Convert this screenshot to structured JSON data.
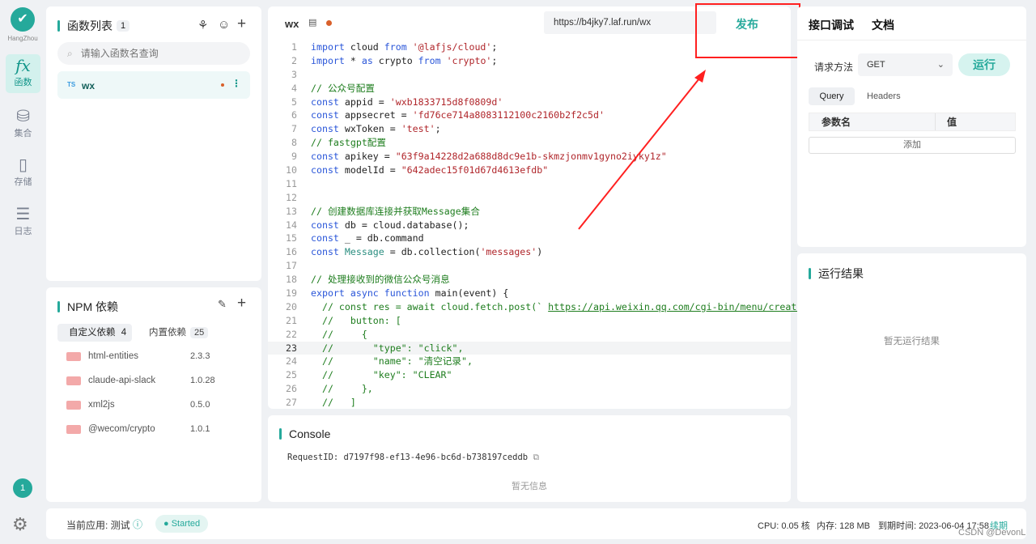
{
  "sidebar": {
    "region": "HangZhou",
    "items": [
      {
        "label": "函数",
        "icon": "function-icon"
      },
      {
        "label": "集合",
        "icon": "database-icon"
      },
      {
        "label": "存储",
        "icon": "storage-icon"
      },
      {
        "label": "日志",
        "icon": "log-icon"
      }
    ],
    "notification_count": "1"
  },
  "functions": {
    "title": "函数列表",
    "count": "1",
    "search_placeholder": "请输入函数名查询",
    "items": [
      {
        "lang": "TS",
        "name": "wx"
      }
    ]
  },
  "npm": {
    "title": "NPM 依赖",
    "tabs": [
      {
        "label": "自定义依赖",
        "count": "4"
      },
      {
        "label": "内置依赖",
        "count": "25"
      }
    ],
    "packages": [
      {
        "name": "html-entities",
        "version": "2.3.3"
      },
      {
        "name": "claude-api-slack",
        "version": "1.0.28"
      },
      {
        "name": "xml2js",
        "version": "0.5.0"
      },
      {
        "name": "@wecom/crypto",
        "version": "1.0.1"
      }
    ]
  },
  "editor": {
    "filename": "wx",
    "url": "https://b4jky7.laf.run/wx",
    "publish_label": "发布",
    "highlighted_line": 23,
    "lines": [
      [
        [
          "kw",
          "import"
        ],
        [
          "tx",
          " cloud "
        ],
        [
          "kw",
          "from"
        ],
        [
          "tx",
          " "
        ],
        [
          "str",
          "'@lafjs/cloud'"
        ],
        [
          "tx",
          ";"
        ]
      ],
      [
        [
          "kw",
          "import"
        ],
        [
          "tx",
          " * "
        ],
        [
          "kw",
          "as"
        ],
        [
          "tx",
          " crypto "
        ],
        [
          "kw",
          "from"
        ],
        [
          "tx",
          " "
        ],
        [
          "str",
          "'crypto'"
        ],
        [
          "tx",
          ";"
        ]
      ],
      [],
      [
        [
          "cm",
          "// 公众号配置"
        ]
      ],
      [
        [
          "kw",
          "const"
        ],
        [
          "tx",
          " appid = "
        ],
        [
          "str",
          "'wxb1833715d8f0809d'"
        ]
      ],
      [
        [
          "kw",
          "const"
        ],
        [
          "tx",
          " appsecret = "
        ],
        [
          "str",
          "'fd76ce714a8083112100c2160b2f2c5d'"
        ]
      ],
      [
        [
          "kw",
          "const"
        ],
        [
          "tx",
          " wxToken = "
        ],
        [
          "str",
          "'test'"
        ],
        [
          "tx",
          ";"
        ]
      ],
      [
        [
          "cm",
          "// fastgpt配置"
        ]
      ],
      [
        [
          "kw",
          "const"
        ],
        [
          "tx",
          " apikey = "
        ],
        [
          "str",
          "\"63f9a14228d2a688d8dc9e1b-skmzjonmv1gyno2iyky1z\""
        ]
      ],
      [
        [
          "kw",
          "const"
        ],
        [
          "tx",
          " modelId = "
        ],
        [
          "str",
          "\"642adec15f01d67d4613efdb\""
        ]
      ],
      [],
      [],
      [
        [
          "cm",
          "// 创建数据库连接并获取Message集合"
        ]
      ],
      [
        [
          "kw",
          "const"
        ],
        [
          "tx",
          " db = cloud.database();"
        ]
      ],
      [
        [
          "kw",
          "const"
        ],
        [
          "tx",
          " _ = db.command"
        ]
      ],
      [
        [
          "kw",
          "const"
        ],
        [
          "tx",
          " "
        ],
        [
          "ty",
          "Message"
        ],
        [
          "tx",
          " = db.collection("
        ],
        [
          "str",
          "'messages'"
        ],
        [
          "tx",
          ")"
        ]
      ],
      [],
      [
        [
          "cm",
          "// 处理接收到的微信公众号消息"
        ]
      ],
      [
        [
          "kw",
          "export"
        ],
        [
          "tx",
          " "
        ],
        [
          "kw",
          "async"
        ],
        [
          "tx",
          " "
        ],
        [
          "kw",
          "function"
        ],
        [
          "tx",
          " main(event) {"
        ]
      ],
      [
        [
          "cm",
          "  // const res = await cloud.fetch.post(` "
        ],
        [
          "url",
          "https://api.weixin.qq.com/cgi-bin/menu/create"
        ]
      ],
      [
        [
          "cm",
          "  //   button: ["
        ]
      ],
      [
        [
          "cm",
          "  //     {"
        ]
      ],
      [
        [
          "cm",
          "  //       \"type\": \"click\","
        ]
      ],
      [
        [
          "cm",
          "  //       \"name\": \"清空记录\","
        ]
      ],
      [
        [
          "cm",
          "  //       \"key\": \"CLEAR\""
        ]
      ],
      [
        [
          "cm",
          "  //     },"
        ]
      ],
      [
        [
          "cm",
          "  //   ]"
        ]
      ]
    ]
  },
  "console": {
    "title": "Console",
    "request_id": "RequestID: d7197f98-ef13-4e96-bc6d-b738197ceddb",
    "empty": "暂无信息"
  },
  "debug": {
    "tabs": [
      "接口调试",
      "文档"
    ],
    "method_label": "请求方法",
    "method": "GET",
    "run_label": "运行",
    "subtabs": [
      "Query",
      "Headers"
    ],
    "columns": [
      "参数名",
      "值"
    ],
    "add_label": "添加"
  },
  "result": {
    "title": "运行结果",
    "empty": "暂无运行结果"
  },
  "footer": {
    "app": "当前应用: 测试",
    "status": "Started",
    "cpu": "CPU: 0.05 核",
    "memory": "内存: 128 MB",
    "expiry": "到期时间: 2023-06-04 17:58",
    "renew": "续期",
    "watermark": "CSDN @DevonL"
  },
  "colors": {
    "accent": "#25a99b",
    "annotation": "#ff2020"
  }
}
